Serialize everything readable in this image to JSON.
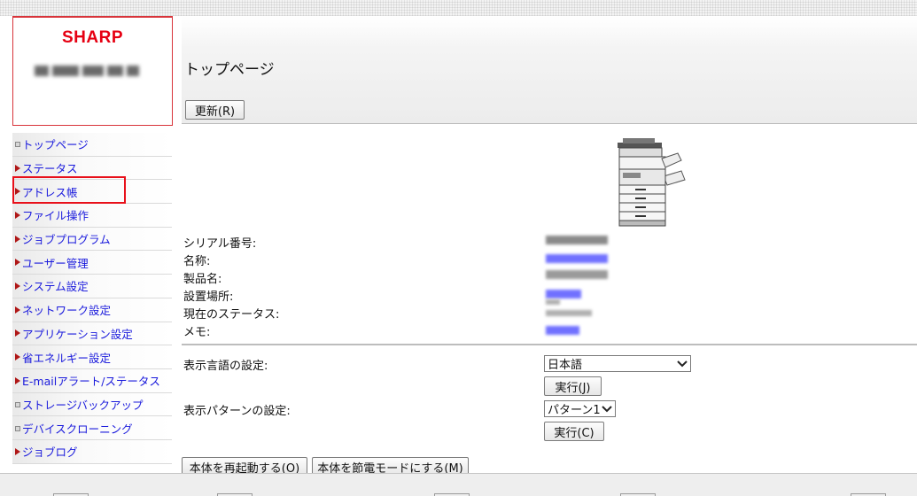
{
  "brand": {
    "name": "SHARP"
  },
  "nav": {
    "items": [
      {
        "label": "トップページ",
        "icon": "square-bullet-icon"
      },
      {
        "label": "ステータス",
        "icon": "triangle-right-icon"
      },
      {
        "label": "アドレス帳",
        "icon": "triangle-right-icon"
      },
      {
        "label": "ファイル操作",
        "icon": "triangle-right-icon"
      },
      {
        "label": "ジョブプログラム",
        "icon": "triangle-right-icon"
      },
      {
        "label": "ユーザー管理",
        "icon": "triangle-right-icon"
      },
      {
        "label": "システム設定",
        "icon": "triangle-right-icon"
      },
      {
        "label": "ネットワーク設定",
        "icon": "triangle-right-icon"
      },
      {
        "label": "アプリケーション設定",
        "icon": "triangle-right-icon"
      },
      {
        "label": "省エネルギー設定",
        "icon": "triangle-right-icon"
      },
      {
        "label": "E-mailアラート/ステータス",
        "icon": "triangle-right-icon"
      },
      {
        "label": "ストレージバックアップ",
        "icon": "square-bullet-icon"
      },
      {
        "label": "デバイスクローニング",
        "icon": "square-bullet-icon"
      },
      {
        "label": "ジョブログ",
        "icon": "triangle-right-icon"
      }
    ],
    "highlighted_item": "アドレス帳"
  },
  "header": {
    "title": "トップページ",
    "refresh_label": "更新(R)"
  },
  "device_info": {
    "serial_label": "シリアル番号:",
    "name_label": "名称:",
    "product_label": "製品名:",
    "location_label": "設置場所:",
    "status_label": "現在のステータス:",
    "memo_label": "メモ:"
  },
  "settings": {
    "language_label": "表示言語の設定:",
    "language_value": "日本語",
    "language_exec": "実行(J)",
    "pattern_label": "表示パターンの設定:",
    "pattern_value": "パターン1",
    "pattern_exec": "実行(C)"
  },
  "actions": {
    "restart_label": "本体を再起動する(O)",
    "power_save_label": "本体を節電モードにする(M)"
  },
  "colors": {
    "brand_red": "#e60012",
    "link_blue": "#1a1adc",
    "highlight_red": "#e8101a"
  }
}
